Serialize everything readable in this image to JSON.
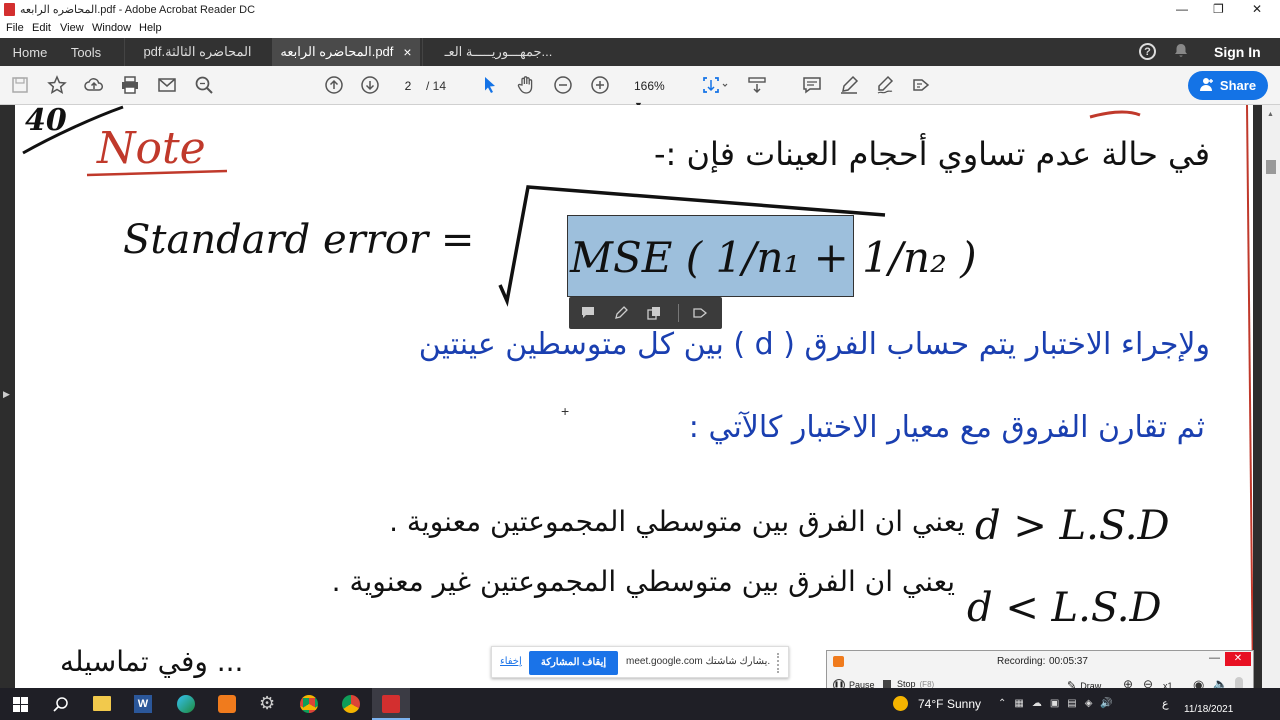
{
  "window": {
    "title": "المحاضره الرابعه.pdf - Adobe Acrobat Reader DC",
    "controls": [
      "—",
      "❐",
      "✕"
    ]
  },
  "menu": [
    "File",
    "Edit",
    "View",
    "Window",
    "Help"
  ],
  "tabs": {
    "home": "Home",
    "tools": "Tools",
    "docs": [
      "المحاضره الثالثة.pdf",
      "المحاضره الرابعه.pdf",
      "جمهـــوريـــــة العـ..."
    ],
    "close": "×"
  },
  "header_right": {
    "sign_in": "Sign In",
    "help": "?"
  },
  "toolbar": {
    "page_current": "2",
    "page_total": "/ 14",
    "zoom": "166%",
    "share": "Share"
  },
  "document": {
    "page_number": "40",
    "note": "Note",
    "arabic_line1": "في حالة عدم تساوي أحجام العينات فإن :-",
    "standard_error": "Standard error =",
    "formula": "MSE ( 1/n₁ + 1/n₂ )",
    "arabic_line2": "ولإجراء الاختبار يتم حساب الفرق ( d ) بين كل متوسطين عينتين",
    "arabic_line3": "ثم تقارن الفروق مع معيار الاختبار كالآتي :",
    "rule1_lhs": "d > L.S.D",
    "rule1_text": "يعني ان الفرق بين متوسطي المجموعتين معنوية .",
    "rule2_lhs": "d < L.S.D",
    "rule2_text": "يعني ان الفرق بين متوسطي المجموعتين غير معنوية .",
    "arabic_line6": "... وفي تماسيله"
  },
  "meet_bar": {
    "text": "meet.google.com يشارك شاشتك.",
    "stop": "إيقاف المشاركة",
    "hide": "إخفاء"
  },
  "recorder": {
    "label": "Recording:",
    "time": "00:05:37",
    "pause": "Pause",
    "stop": "Stop",
    "stop_key": "(F8)",
    "draw": "Draw",
    "zoom": "x1"
  },
  "taskbar": {
    "weather_temp": "74°F",
    "weather_text": "Sunny",
    "lang": "ع",
    "date": "11/18/2021"
  }
}
